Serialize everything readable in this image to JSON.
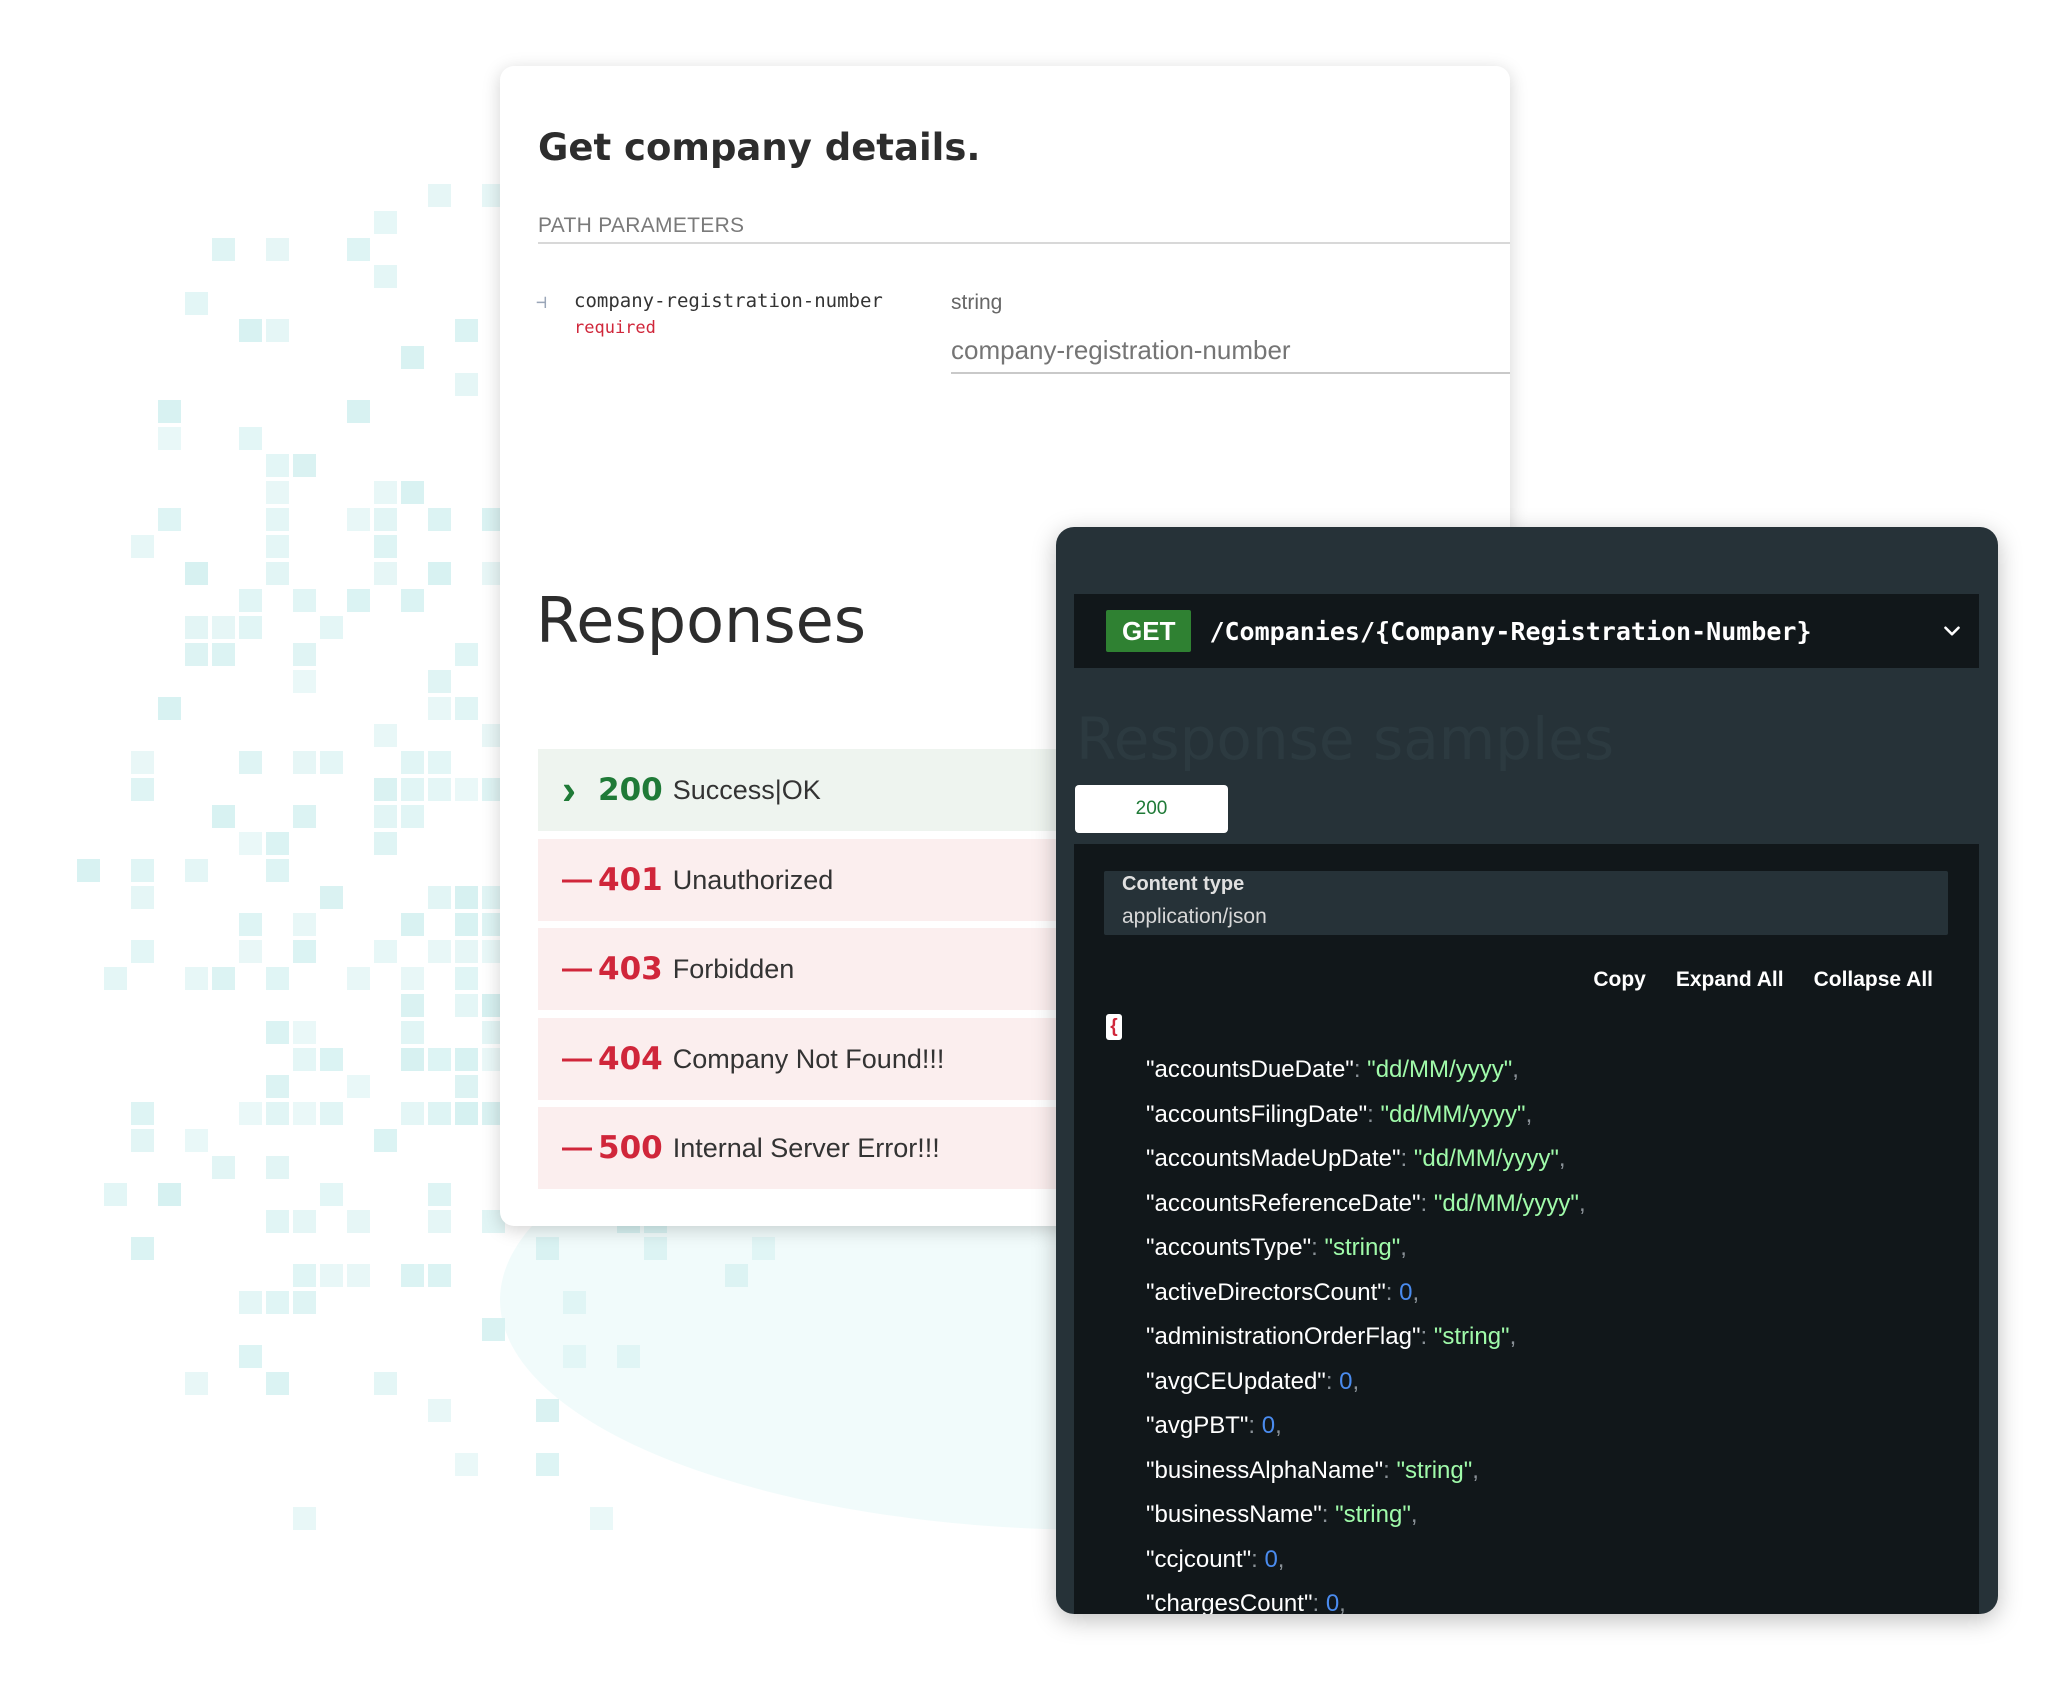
{
  "operation": {
    "title": "Get company details.",
    "path_params_label": "PATH PARAMETERS",
    "param": {
      "name": "company-registration-number",
      "required": "required",
      "type": "string",
      "placeholder": "company-registration-number"
    }
  },
  "responses": {
    "title": "Responses",
    "items": [
      {
        "code": "200",
        "desc": "Success|OK",
        "kind": "ok"
      },
      {
        "code": "401",
        "desc": "Unauthorized",
        "kind": "err"
      },
      {
        "code": "403",
        "desc": "Forbidden",
        "kind": "err"
      },
      {
        "code": "404",
        "desc": "Company Not Found!!!",
        "kind": "err"
      },
      {
        "code": "500",
        "desc": "Internal Server Error!!!",
        "kind": "err"
      }
    ]
  },
  "endpoint": {
    "method": "GET",
    "path": "/Companies/{Company-Registration-Number}"
  },
  "samples": {
    "title": "Response samples",
    "tab_label": "200",
    "content_type_label": "Content type",
    "content_type_value": "application/json",
    "copy_label": "Copy",
    "expand_label": "Expand All",
    "collapse_label": "Collapse All",
    "json": [
      {
        "key": "accountsDueDate",
        "value": "\"dd/MM/yyyy\"",
        "type": "str"
      },
      {
        "key": "accountsFilingDate",
        "value": "\"dd/MM/yyyy\"",
        "type": "str"
      },
      {
        "key": "accountsMadeUpDate",
        "value": "\"dd/MM/yyyy\"",
        "type": "str"
      },
      {
        "key": "accountsReferenceDate",
        "value": "\"dd/MM/yyyy\"",
        "type": "str"
      },
      {
        "key": "accountsType",
        "value": "\"string\"",
        "type": "str"
      },
      {
        "key": "activeDirectorsCount",
        "value": "0",
        "type": "num"
      },
      {
        "key": "administrationOrderFlag",
        "value": "\"string\"",
        "type": "str"
      },
      {
        "key": "avgCEUpdated",
        "value": "0",
        "type": "num"
      },
      {
        "key": "avgPBT",
        "value": "0",
        "type": "num"
      },
      {
        "key": "businessAlphaName",
        "value": "\"string\"",
        "type": "str"
      },
      {
        "key": "businessName",
        "value": "\"string\"",
        "type": "str"
      },
      {
        "key": "ccjcount",
        "value": "0",
        "type": "num"
      },
      {
        "key": "chargesCount",
        "value": "0",
        "type": "num"
      }
    ]
  }
}
